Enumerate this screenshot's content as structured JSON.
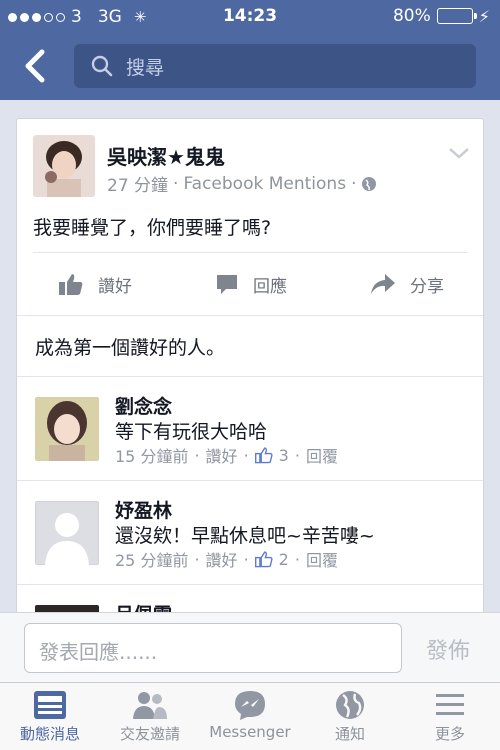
{
  "status": {
    "carrier": "3",
    "network": "3G",
    "time": "14:23",
    "battery": "80%",
    "battery_level": 0.8
  },
  "search": {
    "placeholder": "搜尋"
  },
  "post": {
    "author": "吳映潔★鬼鬼",
    "time": "27 分鐘",
    "separator": "·",
    "source": "Facebook Mentions",
    "text": "我要睡覺了，你們要睡了嗎?",
    "actions": {
      "like": "讚好",
      "comment": "回應",
      "share": "分享"
    },
    "first_like": "成為第一個讚好的人。"
  },
  "comments": [
    {
      "name": "劉念念",
      "text": "等下有玩很大哈哈",
      "time": "15 分鐘前",
      "like": "讚好",
      "likes": "3",
      "reply": "回覆"
    },
    {
      "name": "妤盈林",
      "text": "還沒欸！早點休息吧~辛苦嘍~",
      "time": "25 分鐘前",
      "like": "讚好",
      "likes": "2",
      "reply": "回覆"
    },
    {
      "name": "呂佩雯"
    }
  ],
  "compose": {
    "placeholder": "發表回應......",
    "post": "發佈"
  },
  "tabs": [
    {
      "label": "動態消息",
      "icon": "news-feed-icon"
    },
    {
      "label": "交友邀請",
      "icon": "friend-requests-icon"
    },
    {
      "label": "Messenger",
      "icon": "messenger-icon"
    },
    {
      "label": "通知",
      "icon": "globe-icon"
    },
    {
      "label": "更多",
      "icon": "menu-icon"
    }
  ],
  "colors": {
    "header": "#4e69a2",
    "search_bg": "#3d5487",
    "accent": "#4e69a2",
    "battery": "#4cd964"
  }
}
